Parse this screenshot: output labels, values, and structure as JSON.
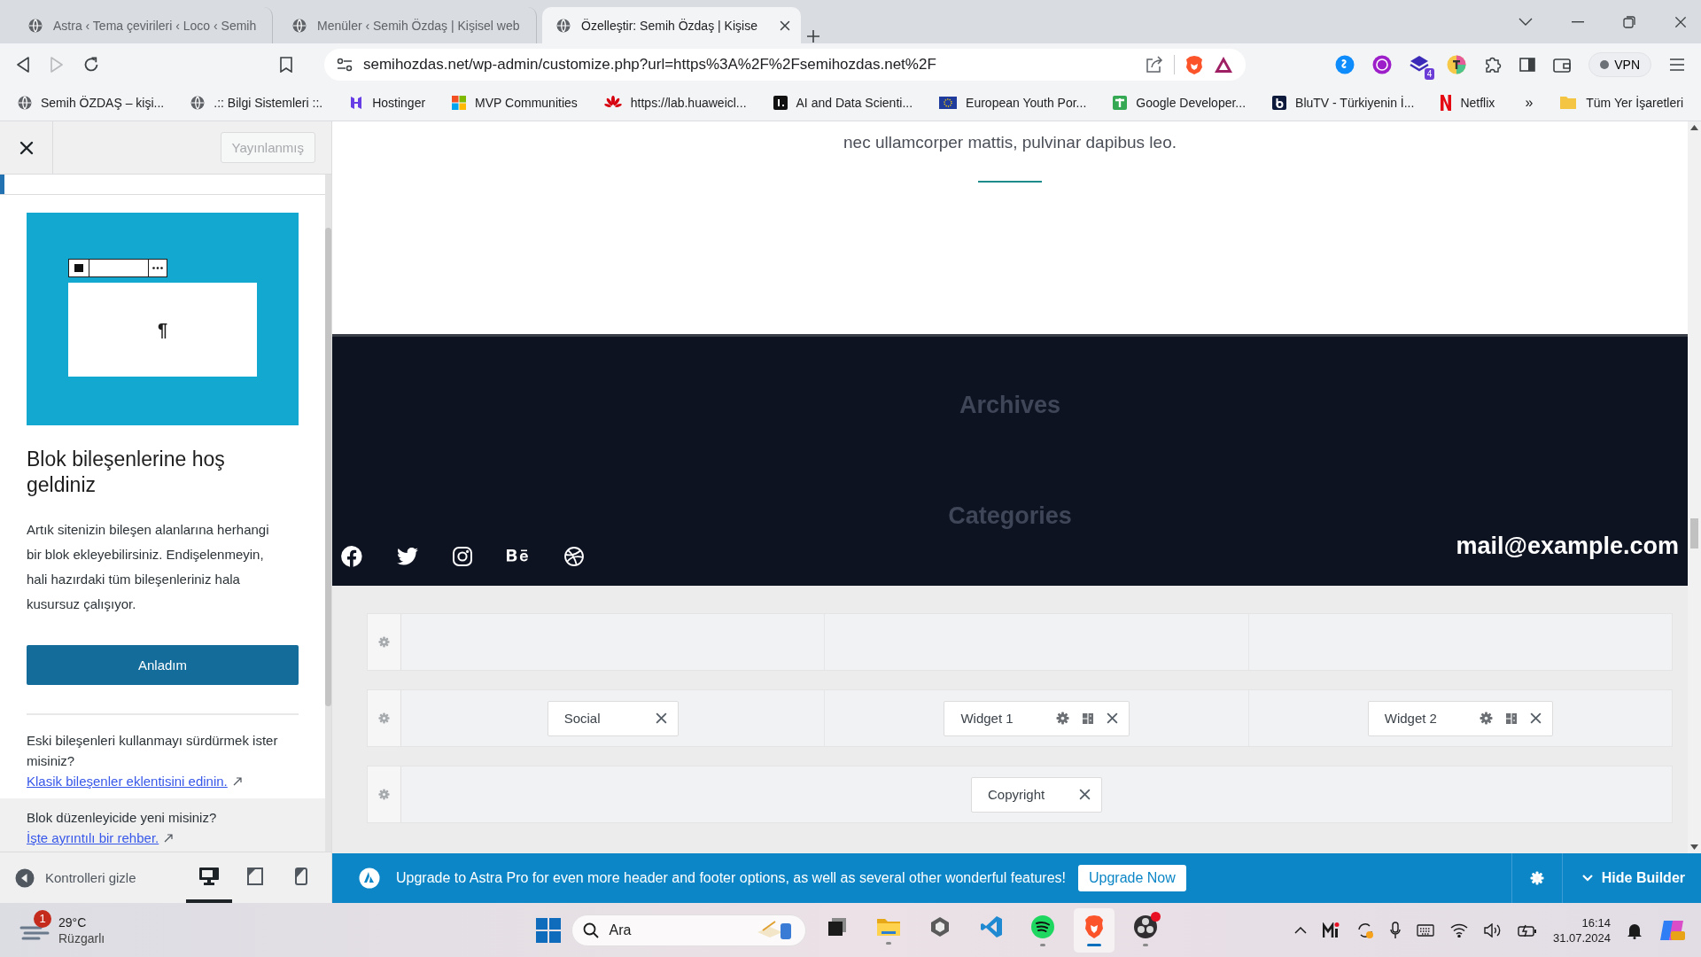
{
  "browser": {
    "tabs": [
      {
        "title": "Astra ‹ Tema çevirileri ‹ Loco ‹ Semih",
        "selected": false
      },
      {
        "title": "Menüler ‹ Semih Özdaş | Kişisel web",
        "selected": false
      },
      {
        "title": "Özelleştir: Semih Özdaş | Kişise",
        "selected": true
      }
    ],
    "address": "semihozdas.net/wp-admin/customize.php?url=https%3A%2F%2Fsemihozdas.net%2F",
    "extension_badge": "4",
    "vpn": "VPN",
    "bookmarks": [
      {
        "label": "Semih ÖZDAŞ – kişi...",
        "kind": "globe"
      },
      {
        "label": ".:: Bilgi Sistemleri ::.",
        "kind": "globe"
      },
      {
        "label": "Hostinger",
        "kind": "hostinger"
      },
      {
        "label": "MVP Communities",
        "kind": "windows"
      },
      {
        "label": "https://lab.huaweicl...",
        "kind": "huawei"
      },
      {
        "label": "AI and Data Scienti...",
        "kind": "square"
      },
      {
        "label": "European Youth Por...",
        "kind": "eu"
      },
      {
        "label": "Google Developer...",
        "kind": "plus"
      },
      {
        "label": "BluTV - Türkiyenin İ...",
        "kind": "b"
      },
      {
        "label": "Netflix",
        "kind": "netflix"
      }
    ],
    "more_bookmarks": "»",
    "all_bookmarks": "Tüm Yer İşaretleri"
  },
  "customizer": {
    "publish_button": "Yayınlanmış",
    "paragraph_mark": "¶",
    "welcome_title": "Blok bileşenlerine hoş geldiniz",
    "welcome_body": "Artık sitenizin bileşen alanlarına herhangi bir blok ekleyebilirsiniz. Endişelenmeyin, hali hazırdaki tüm bileşenleriniz hala kusursuz çalışıyor.",
    "got_it_button": "Anladım",
    "legacy_question": "Eski bileşenleri kullanmayı sürdürmek ister misiniz?",
    "legacy_link": "Klasik bileşenler eklentisini edinin.",
    "new_question": "Blok düzenleyicide yeni misiniz?",
    "guide_link": "İşte ayrıntılı bir rehber.",
    "hide_controls": "Kontrolleri gizle",
    "devices": [
      {
        "kind": "desktop",
        "selected": true
      },
      {
        "kind": "tablet",
        "selected": false
      },
      {
        "kind": "mobile",
        "selected": false
      }
    ]
  },
  "preview": {
    "text": "nec ullamcorper mattis, pulvinar dapibus leo.",
    "footer_headings": [
      "Archives",
      "Categories"
    ],
    "social": [
      {
        "kind": "facebook"
      },
      {
        "kind": "twitter"
      },
      {
        "kind": "instagram"
      },
      {
        "kind": "behance"
      },
      {
        "kind": "dribbble"
      }
    ],
    "email": "mail@example.com",
    "builder_rows": [
      {
        "columns": [
          [],
          [],
          []
        ]
      },
      {
        "columns": [
          [
            {
              "label": "Social",
              "kind": "simple"
            }
          ],
          [
            {
              "label": "Widget 1",
              "kind": "widget"
            }
          ],
          [
            {
              "label": "Widget 2",
              "kind": "widget"
            }
          ]
        ]
      },
      {
        "columns": [
          [
            {
              "label": "Copyright",
              "kind": "simple"
            }
          ]
        ]
      }
    ],
    "upgrade_text": "Upgrade to Astra Pro for even more header and footer options, as well as several other wonderful features!",
    "upgrade_button": "Upgrade Now",
    "hide_builder": "Hide Builder"
  },
  "taskbar": {
    "temperature": "29°C",
    "condition": "Rüzgarlı",
    "weather_badge": "1",
    "search_placeholder": "Ara",
    "apps": [
      {
        "kind": "taskview",
        "running": false,
        "selected": false
      },
      {
        "kind": "folder",
        "running": true,
        "selected": false
      },
      {
        "kind": "cube",
        "running": false,
        "selected": false
      },
      {
        "kind": "code",
        "running": false,
        "selected": false
      },
      {
        "kind": "spotify",
        "running": true,
        "selected": false
      },
      {
        "kind": "lion",
        "running": true,
        "selected": true
      },
      {
        "kind": "record",
        "running": true,
        "selected": false
      }
    ],
    "time": "16:14",
    "date": "31.07.2024"
  }
}
